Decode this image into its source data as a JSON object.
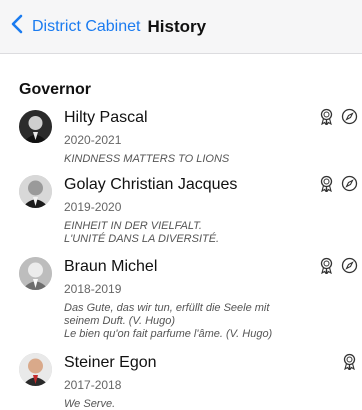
{
  "nav": {
    "back_label": "District Cabinet",
    "title": "History"
  },
  "section": {
    "title": "Governor"
  },
  "entries": [
    {
      "name": "Hilty Pascal",
      "years": "2020-2021",
      "motto": [
        "KINDNESS MATTERS TO LIONS"
      ],
      "icons": [
        "award-icon",
        "compass-icon"
      ]
    },
    {
      "name": "Golay Christian Jacques",
      "years": "2019-2020",
      "motto": [
        "EINHEIT IN DER VIELFALT.",
        "L'UNITÉ DANS LA DIVERSITÉ."
      ],
      "icons": [
        "award-icon",
        "compass-icon"
      ]
    },
    {
      "name": "Braun Michel",
      "years": "2018-2019",
      "motto": [
        "Das Gute, das wir tun, erfüllt die Seele mit",
        "seinem Duft. (V. Hugo)",
        "Le bien qu'on fait parfume l'âme. (V. Hugo)"
      ],
      "icons": [
        "award-icon",
        "compass-icon"
      ]
    },
    {
      "name": "Steiner Egon",
      "years": "2017-2018",
      "motto": [
        "We Serve."
      ],
      "icons": [
        "award-icon"
      ]
    }
  ],
  "colors": {
    "accent": "#1a7bf0",
    "navbar_bg": "#f6f6f7"
  }
}
